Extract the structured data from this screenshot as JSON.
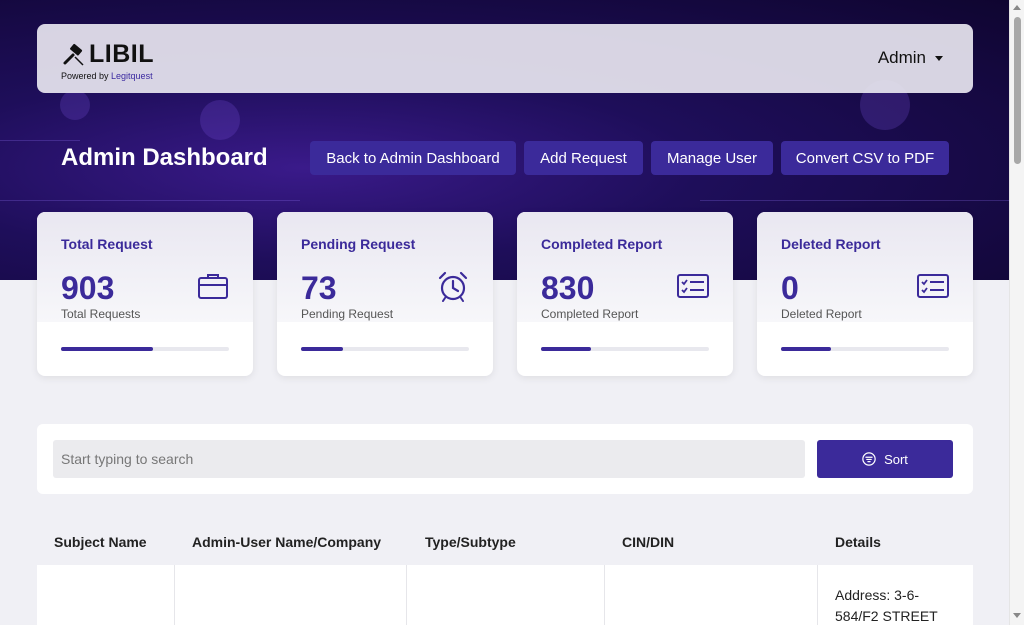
{
  "navbar": {
    "logo_text": "LIBIL",
    "powered_by": "Powered by ",
    "powered_by_brand": "Legitquest",
    "admin_label": "Admin"
  },
  "header": {
    "title": "Admin Dashboard",
    "buttons": [
      "Back to Admin Dashboard",
      "Add Request",
      "Manage User",
      "Convert CSV to PDF"
    ]
  },
  "cards": [
    {
      "title": "Total Request",
      "value": "903",
      "sub": "Total Requests",
      "icon": "briefcase-icon",
      "progress": 0.55
    },
    {
      "title": "Pending Request",
      "value": "73",
      "sub": "Pending Request",
      "icon": "alarm-clock-icon",
      "progress": 0.25
    },
    {
      "title": "Completed Report",
      "value": "830",
      "sub": "Completed Report",
      "icon": "checklist-icon",
      "progress": 0.3
    },
    {
      "title": "Deleted Report",
      "value": "0",
      "sub": "Deleted Report",
      "icon": "checklist-icon",
      "progress": 0.3
    }
  ],
  "search": {
    "placeholder": "Start typing to search",
    "sort_label": "Sort"
  },
  "table": {
    "headers": [
      "Subject Name",
      "Admin-User Name/Company",
      "Type/Subtype",
      "CIN/DIN",
      "Details"
    ],
    "rows": [
      {
        "details": "Address: 3-6-584/F2 STREET"
      }
    ]
  },
  "colors": {
    "accent": "#3b2a9a",
    "hero_dark": "#0f0530"
  }
}
